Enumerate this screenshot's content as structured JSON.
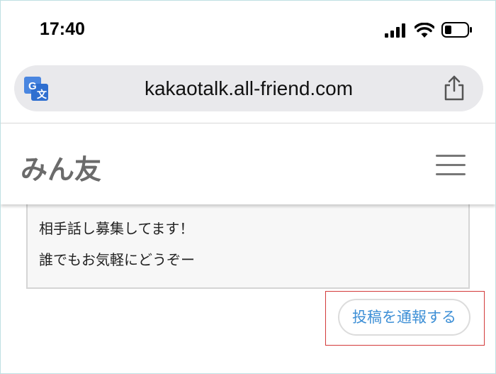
{
  "status_bar": {
    "time": "17:40",
    "icons": [
      "signal-icon",
      "wifi-icon",
      "battery-icon"
    ]
  },
  "browser": {
    "url": "kakaotalk.all-friend.com",
    "left_icon": "translate-icon",
    "right_icon": "share-icon"
  },
  "site": {
    "logo": "みん友",
    "menu_icon": "hamburger-menu-icon"
  },
  "post": {
    "lines": [
      "相手話し募集してます！",
      "誰でもお気軽にどうぞー"
    ]
  },
  "actions": {
    "report_label": "投稿を通報する"
  },
  "colors": {
    "accent": "#3d8fd6",
    "highlight": "#d33a3a",
    "logo": "#6b6b6b"
  }
}
